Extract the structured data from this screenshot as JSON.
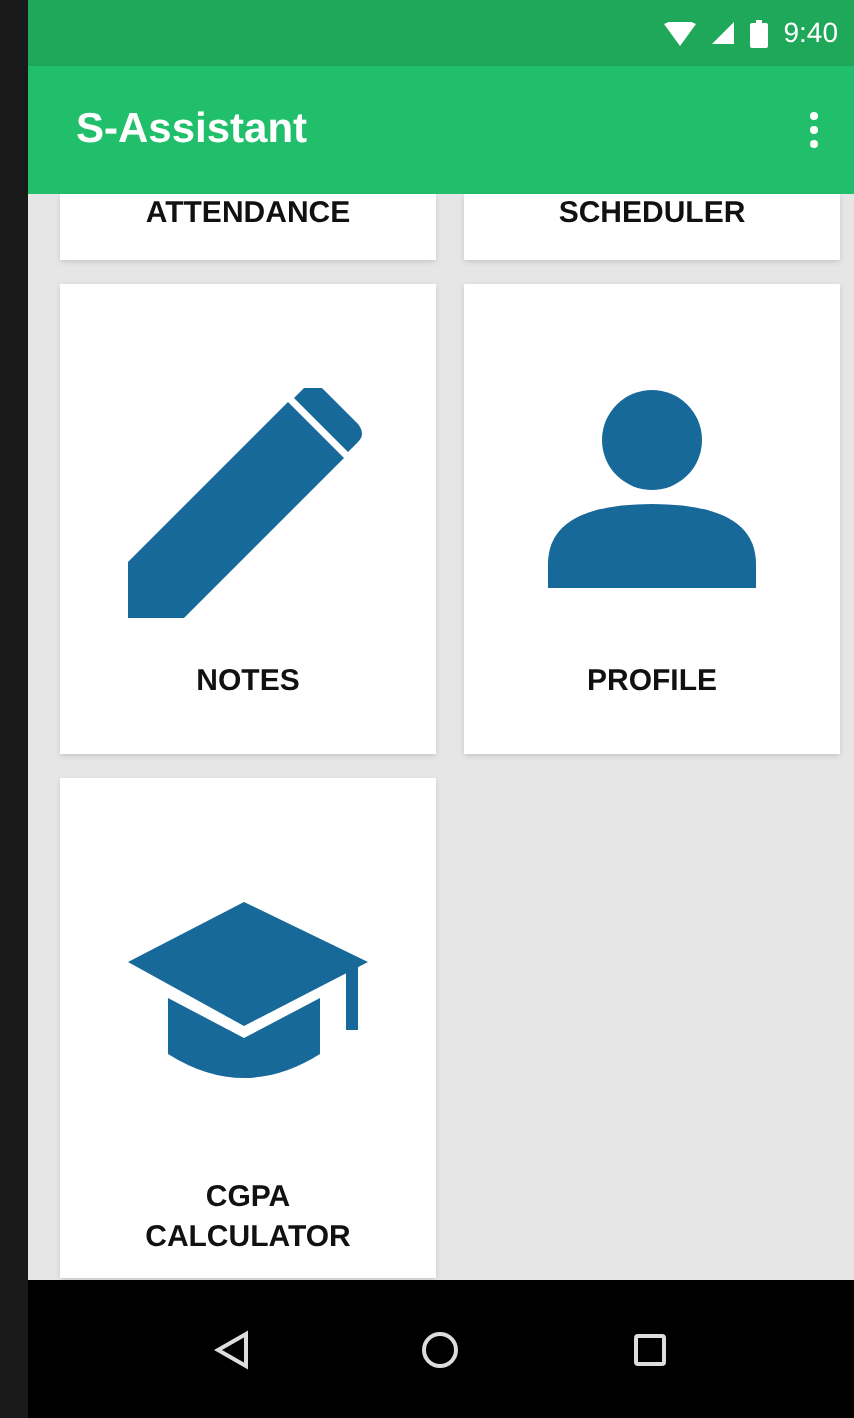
{
  "status_bar": {
    "time": "9:40"
  },
  "app_bar": {
    "title": "S-Assistant"
  },
  "tiles": [
    {
      "label": "ATTENDANCE",
      "kind": "partial"
    },
    {
      "label": "SCHEDULER",
      "kind": "partial"
    },
    {
      "label": "NOTES",
      "kind": "pencil"
    },
    {
      "label": "PROFILE",
      "kind": "person"
    },
    {
      "label": "CGPA\nCALCULATOR",
      "kind": "cap"
    }
  ]
}
